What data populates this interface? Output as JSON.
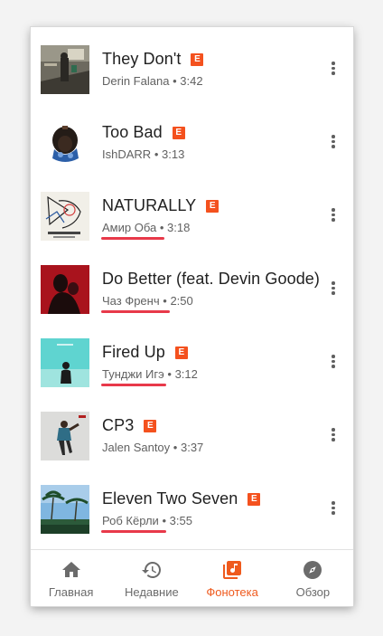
{
  "tracks": [
    {
      "title": "They Don't",
      "artist": "Derin Falana",
      "duration": "3:42",
      "explicit_label": "E"
    },
    {
      "title": "Too Bad",
      "artist": "IshDARR",
      "duration": "3:13",
      "explicit_label": "E"
    },
    {
      "title": "NATURALLY",
      "artist": "Амир Оба",
      "duration": "3:18",
      "explicit_label": "E"
    },
    {
      "title": "Do Better (feat. Devin Goode)",
      "artist": "Чаз Френч",
      "duration": "2:50",
      "explicit_label": "E"
    },
    {
      "title": "Fired Up",
      "artist": "Тунджи Игэ",
      "duration": "3:12",
      "explicit_label": "E"
    },
    {
      "title": "CP3",
      "artist": "Jalen Santoy",
      "duration": "3:37",
      "explicit_label": "E"
    },
    {
      "title": "Eleven Two Seven",
      "artist": "Роб Кёрли",
      "duration": "3:55",
      "explicit_label": "E"
    }
  ],
  "separator": "•",
  "nav": {
    "items": [
      {
        "label": "Главная",
        "icon": "home-icon"
      },
      {
        "label": "Недавние",
        "icon": "history-icon"
      },
      {
        "label": "Фонотека",
        "icon": "library-music-icon"
      },
      {
        "label": "Обзор",
        "icon": "explore-icon"
      }
    ],
    "active_index": 2
  },
  "colors": {
    "accent": "#ef5a1d",
    "explicit_badge": "#f4511e",
    "highlight_underline": "#e8394a",
    "text_primary": "#212121",
    "text_secondary": "#616161"
  }
}
